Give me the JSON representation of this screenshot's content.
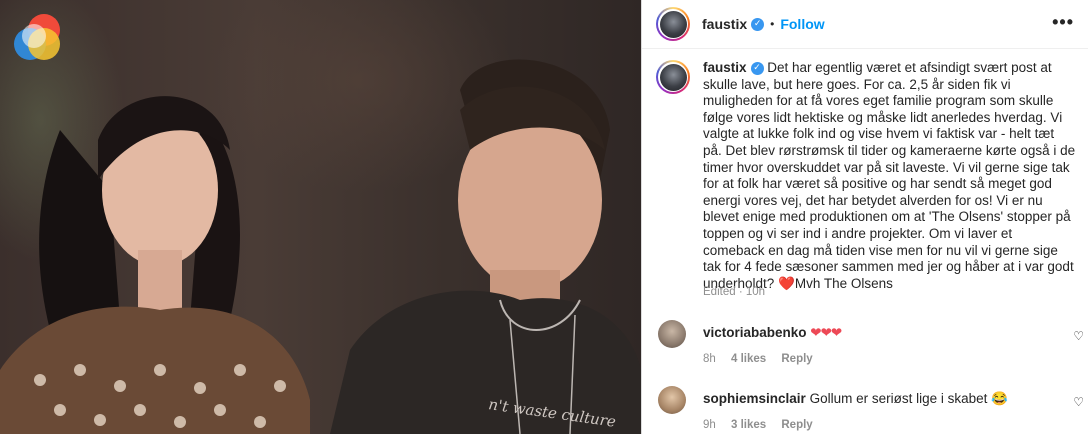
{
  "post": {
    "username": "faustix",
    "follow_label": "Follow",
    "more_label": "•••",
    "dot": "•",
    "caption": "Det har egentlig været et afsindigt svært post at skulle lave, but here goes. For ca. 2,5 år siden fik vi muligheden for at få vores eget familie program som skulle følge vores lidt hektiske og måske lidt anerledes hverdag. Vi valgte at lukke folk ind og vise hvem vi faktisk var - helt tæt på. Det blev rørstrømsk til tider og kameraerne kørte også i de timer hvor overskuddet var på sit laveste. Vi vil gerne sige tak for at folk har været så positive og har sendt så meget god energi vores vej, det har betydet alverden for os! Vi er nu blevet enige med produktionen om at 'The Olsens' stopper på toppen og vi ser ind i andre projekter. Om vi laver et comeback en dag må tiden vise men for nu vil vi gerne sige tak for 4 fede sæsoner sammen med jer og håber at i var godt underholdt?",
    "caption_heart": "❤️",
    "caption_end": "Mvh The Olsens",
    "edited": "Edited",
    "age": "10h",
    "shirt_text": "n't waste culture"
  },
  "comments": [
    {
      "username": "victoriababenko",
      "text": "",
      "emoji": "❤❤❤",
      "time": "8h",
      "likes": "4 likes",
      "reply": "Reply"
    },
    {
      "username": "sophiemsinclair",
      "text": "Gollum er seriøst lige i skabet",
      "emoji": "😂",
      "time": "9h",
      "likes": "3 likes",
      "reply": "Reply"
    }
  ],
  "colors": {
    "accent": "#0095f6",
    "verified": "#3897f0",
    "heart": "#ed4956",
    "meta_gray": "#8e8e8e"
  },
  "icons": {
    "verified": "check-badge-icon",
    "more": "more-horizontal-icon",
    "like": "heart-outline-icon"
  }
}
